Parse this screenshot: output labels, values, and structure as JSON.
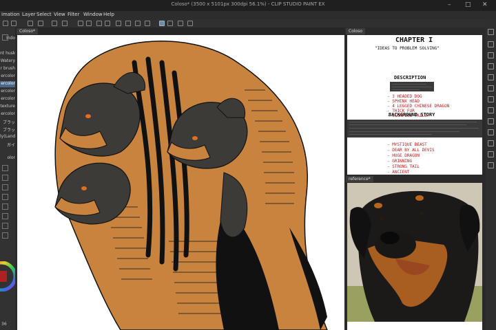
{
  "window": {
    "title": "Coloso* (3500 x 5101px 300dpi 56.1%) - CLIP STUDIO PAINT EX"
  },
  "menu": {
    "items": [
      "imation",
      "Layer",
      "Select",
      "View",
      "Filter",
      "Window",
      "Help"
    ]
  },
  "canvas_tabs": {
    "main": "Coloso*",
    "reference_doc": "Coloso",
    "reference_photo": "reference*"
  },
  "left_panel": {
    "header": "Indo",
    "items": [
      "nt husky",
      "Watery",
      "r brush",
      "ercolor",
      "ercolor",
      "ercolor",
      "ercolor",
      "texture",
      "ercolor",
      "ブラッ",
      "ブラッ",
      "ly(Land)",
      "ガイ"
    ],
    "selected_index": 4,
    "color_label": "olor",
    "zoom_value": "36"
  },
  "notes_page": {
    "heading": "CHAPTER I",
    "subtitle": "\"IDEAS TO PROBLEM SOLVING\"",
    "section_description": "DESCRIPTION",
    "red_list_1": [
      "- 3 HEADED DOG",
      "- SPHINX HEAD",
      "- 4 LEGGED CHINESE DRAGON",
      "- THICK FUR",
      "- SCORPION TAILS"
    ],
    "section_story": "BACKGROUND STORY",
    "red_list_2": [
      "- MYSTIQUE BEAST",
      "- DEAR BY ALL DEVIS",
      "- HUGE DRAGON",
      "- GRINNING",
      "- STRONG TAIL",
      "- ANCIENT"
    ]
  },
  "colors": {
    "fur_orange": "#c8843e",
    "dog_gray": "#3d3b38",
    "accent_blue": "#4a6888",
    "red_note": "#c01818"
  }
}
